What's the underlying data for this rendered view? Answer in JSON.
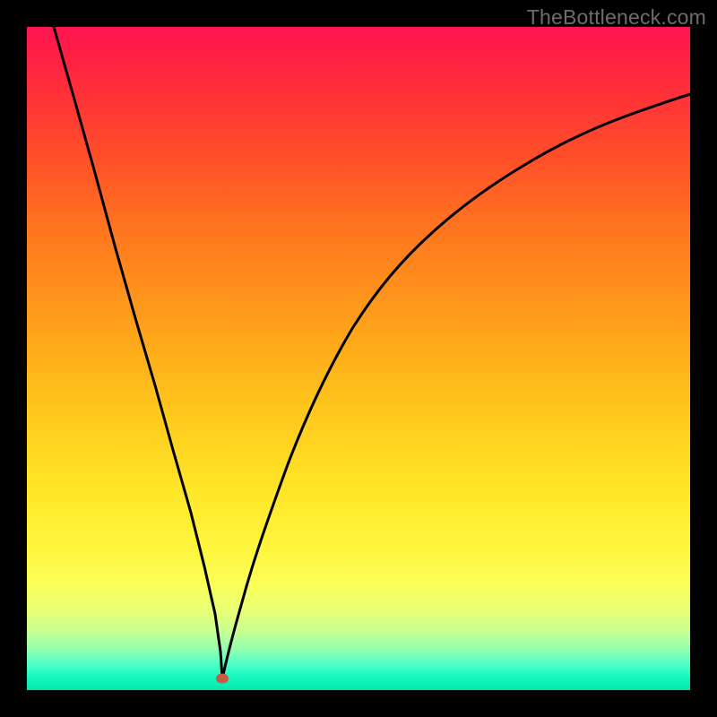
{
  "watermark": "TheBottleneck.com",
  "chart_data": {
    "type": "line",
    "title": "",
    "xlabel": "",
    "ylabel": "",
    "xlim": [
      0,
      100
    ],
    "ylim": [
      0,
      100
    ],
    "legend": false,
    "grid": false,
    "background_gradient": {
      "top_color": "#ff1450",
      "bottom_color": "#00e8a8"
    },
    "series": [
      {
        "name": "left-branch",
        "x": [
          4.0,
          7.1,
          10.2,
          13.3,
          16.4,
          19.3,
          22.1,
          24.7,
          26.8,
          28.3,
          29.2,
          29.5
        ],
        "y": [
          100.0,
          89.0,
          78.0,
          67.0,
          56.1,
          45.9,
          36.2,
          26.8,
          18.6,
          11.5,
          5.8,
          1.8
        ]
      },
      {
        "name": "right-branch",
        "x": [
          29.5,
          30.5,
          32.4,
          35.3,
          39.2,
          43.8,
          49.1,
          55.0,
          61.4,
          68.1,
          75.2,
          82.5,
          90.1,
          97.7,
          100.0
        ],
        "y": [
          1.8,
          5.5,
          13.2,
          23.2,
          33.6,
          43.0,
          51.3,
          58.4,
          64.6,
          69.8,
          74.3,
          78.1,
          81.3,
          84.1,
          84.9
        ]
      }
    ],
    "marker": {
      "name": "optimal-point",
      "x": 29.5,
      "y": 1.8,
      "color": "#c65a44"
    }
  }
}
